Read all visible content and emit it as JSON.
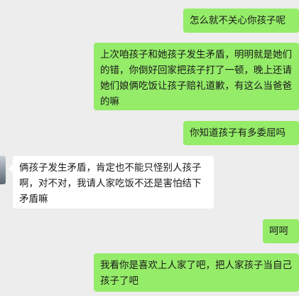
{
  "chat": {
    "messages": [
      {
        "sender": "self",
        "text": "怎么就不关心你孩子呢"
      },
      {
        "sender": "self",
        "text": "上次咱孩子和她孩子发生矛盾，明明就是她们的错，你倒好回家把孩子打了一顿，晚上还请她们娘俩吃饭让孩子赔礼道歉，有这么当爸爸的嘛"
      },
      {
        "sender": "self",
        "text": "你知道孩子有多委屈吗"
      },
      {
        "sender": "other",
        "text": "俩孩子发生矛盾，肯定也不能只怪别人孩子啊，对不对，我请人家吃饭不还是害怕结下矛盾嘛"
      },
      {
        "sender": "self",
        "text": "呵呵"
      },
      {
        "sender": "self",
        "text": "我看你是喜欢上人家了吧，把人家孩子当自己孩子了吧"
      }
    ]
  },
  "colors": {
    "background": "#ededed",
    "outgoing_bubble": "#95ec69",
    "incoming_bubble": "#ffffff"
  }
}
